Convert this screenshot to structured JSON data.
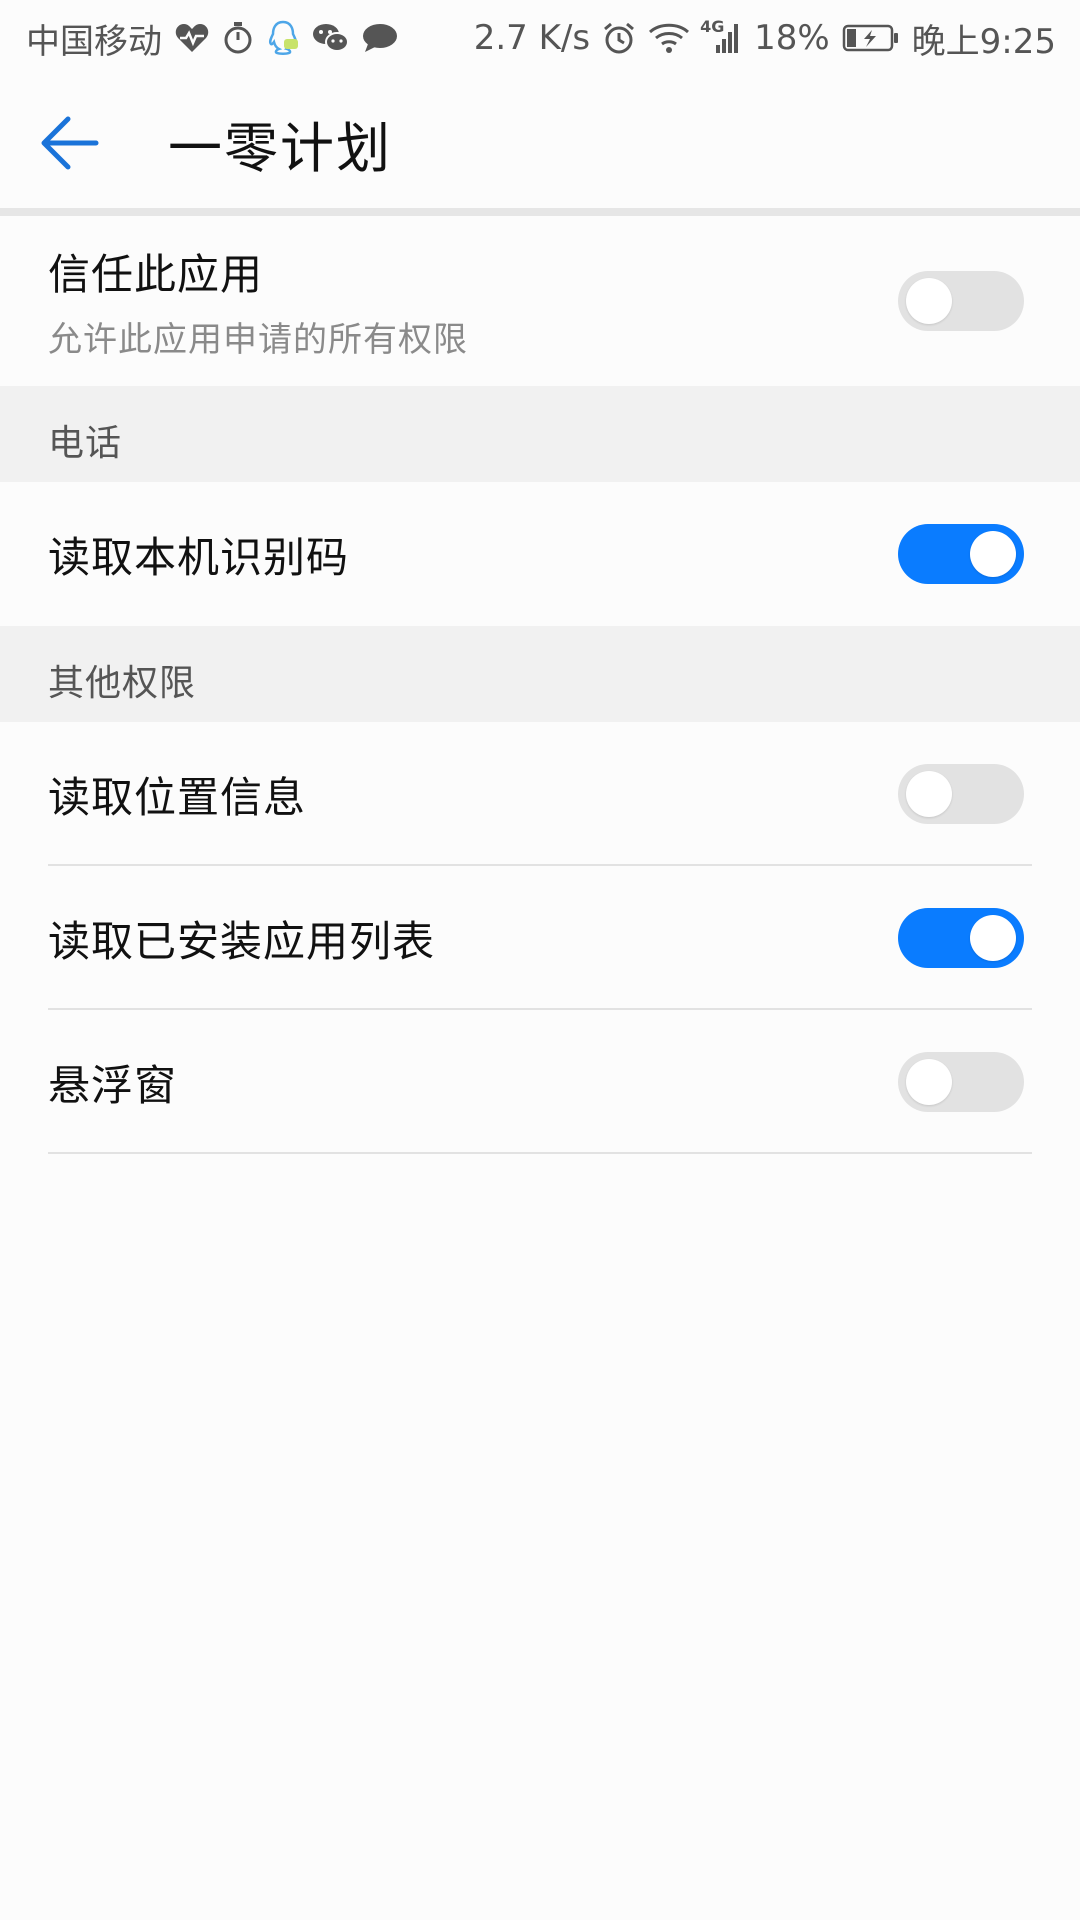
{
  "status_bar": {
    "carrier": "中国移动",
    "net_speed": "2.7 K/s",
    "network_type": "4G",
    "battery_percent": "18%",
    "time": "晚上9:25",
    "icons_left": [
      "heartbeat-icon",
      "stopwatch-icon",
      "qq-icon",
      "wechat-icon",
      "message-bubble-icon"
    ],
    "icons_right": [
      "alarm-icon",
      "wifi-icon",
      "signal-icon",
      "battery-charging-icon"
    ]
  },
  "app_bar": {
    "title": "一零计划",
    "back_icon": "arrow-left-icon"
  },
  "colors": {
    "accent": "#0a7cff",
    "back_arrow": "#1a73d9",
    "toggle_off": "#e2e2e2",
    "section_bg": "#f1f1f1"
  },
  "trust": {
    "title": "信任此应用",
    "subtitle": "允许此应用申请的所有权限",
    "enabled": false
  },
  "sections": [
    {
      "header": "电话",
      "items": [
        {
          "label": "读取本机识别码",
          "enabled": true
        }
      ]
    },
    {
      "header": "其他权限",
      "items": [
        {
          "label": "读取位置信息",
          "enabled": false
        },
        {
          "label": "读取已安装应用列表",
          "enabled": true
        },
        {
          "label": "悬浮窗",
          "enabled": false
        }
      ]
    }
  ]
}
